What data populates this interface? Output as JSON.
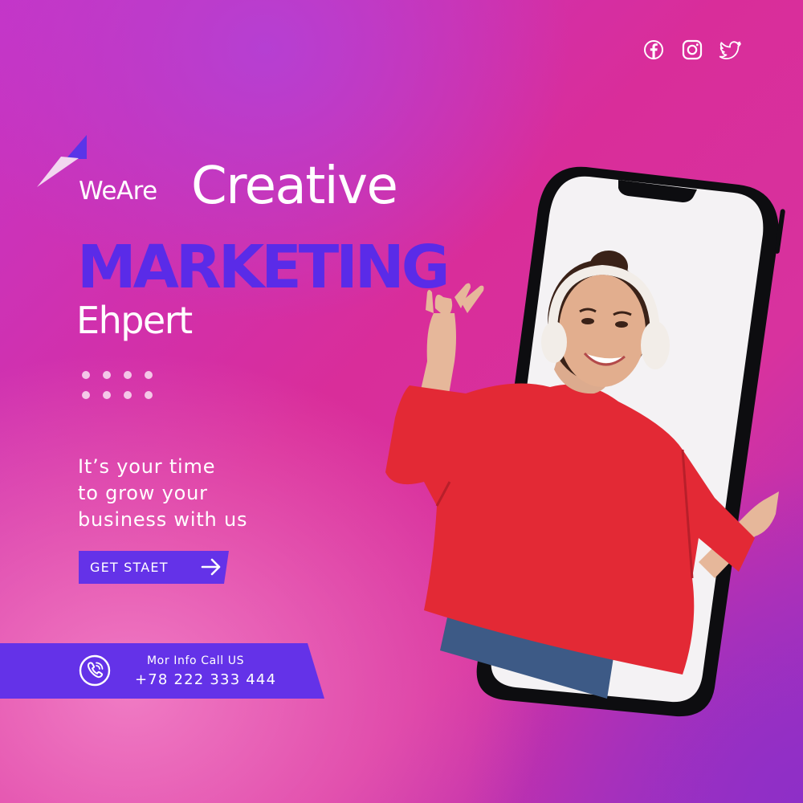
{
  "social": {
    "icons": [
      "facebook-icon",
      "instagram-icon",
      "twitter-icon"
    ]
  },
  "headline": {
    "weare": "WeAre",
    "creative": "Creative",
    "marketing": "MARKETING",
    "ehpert": "Ehpert"
  },
  "tagline": {
    "line1": "It’s your time",
    "line2": "to grow your",
    "line3": "business with us"
  },
  "cta": {
    "label": "GET STAET"
  },
  "contact": {
    "label": "Mor Info Call US",
    "phone": "+78 222 333 444"
  },
  "colors": {
    "accent": "#6432e8",
    "sweater": "#e32935",
    "phone_frame": "#0d0d10"
  }
}
